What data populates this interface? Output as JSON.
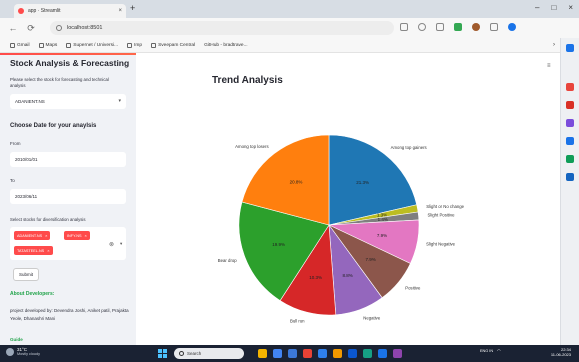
{
  "browser": {
    "tab_title": "app · Streamlit",
    "tab_close": "×",
    "new_tab": "+",
    "window_controls": [
      "–",
      "□",
      "×"
    ],
    "url": "localhost:8501",
    "nav": [
      "←",
      "⟳"
    ],
    "bookmarks": [
      "Gmail",
      "Maps",
      "Supernet / Universi...",
      "Imp",
      "Sveepam Central",
      "GitHub - bradtrave..."
    ],
    "bookmarks_more": "›"
  },
  "sidebar": {
    "title": "Stock Analysis & Forecasting",
    "description": "Please select the stock for forecasting and technical analysis",
    "stock_select_value": "ADANIENT.NS",
    "stock_select_arrow": "▾",
    "date_heading": "Choose Date for your anaylsis",
    "from_label": "From",
    "from_value": "2010/01/01",
    "to_label": "To",
    "to_value": "2023/06/11",
    "multiselect_label": "Select stocks for diversification analysis",
    "chips": [
      "ADANIENT.NS",
      "INFY.NS",
      "TATASTEEL.NS"
    ],
    "chip_remove": "×",
    "multiselect_clear": "⊗",
    "multiselect_arrow": "▾",
    "submit_label": "Submit",
    "about_heading": "About Developers:",
    "about_text": "project developed by: Devendra Joshi, Aniket patil, Prajakta Yeole, Dhanashri Mani",
    "footer_link": "Guide"
  },
  "main": {
    "menu_icon": "≡",
    "chart_title": "Trend Analysis"
  },
  "chart_data": {
    "type": "pie",
    "title": "Trend Analysis",
    "categories": [
      "Among top gainers",
      "Slight or No change",
      "Slight Positive",
      "Slight Negative",
      "Positive",
      "Negative",
      "Bull run",
      "Bear drop",
      "Among top losers"
    ],
    "values": [
      21.3,
      1.3,
      1.4,
      7.9,
      7.9,
      8.8,
      10.3,
      19.9,
      20.8
    ],
    "value_labels": [
      "21.3%",
      "1.3%",
      "1.4%",
      "7.9%",
      "7.9%",
      "8.8%",
      "10.3%",
      "19.9%",
      "20.8%"
    ],
    "colors": [
      "#1f77b4",
      "#bcbd22",
      "#7f7f7f",
      "#e377c2",
      "#8c564b",
      "#9467bd",
      "#d62728",
      "#2ca02c",
      "#ff7f0e"
    ],
    "start_angle_deg": 90,
    "direction": "clockwise",
    "legend": "none"
  },
  "taskbar": {
    "weather_temp": "31°C",
    "weather_desc": "Mostly cloudy",
    "search_text": "Search",
    "tray_lang": "ENG IN",
    "clock_time": "22:34",
    "clock_date": "11-06-2023",
    "app_colors": [
      "#f4b400",
      "#4285f4",
      "#3c78d8",
      "#e94235",
      "#2f80ed",
      "#f29900",
      "#0b57d0",
      "#16a085",
      "#1a73e8",
      "#8e44ad"
    ]
  },
  "edge_sidebar_colors": [
    "#1a73e8",
    "#e8453c",
    "#d93025",
    "#7b4ddb",
    "#1a73e8",
    "#0f9d58",
    "#1565c0"
  ]
}
